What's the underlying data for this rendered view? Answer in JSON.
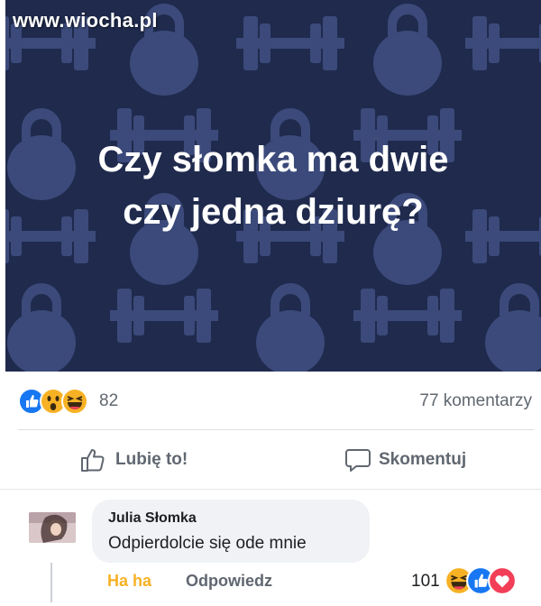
{
  "watermark": "www.wiocha.pl",
  "post": {
    "headline_line1": "Czy słomka ma dwie",
    "headline_line2": "czy jedna dziurę?",
    "image_bg_color": "#1f2a4d",
    "pattern_color": "#3b4a7a"
  },
  "reactions": {
    "icons": [
      "like-icon",
      "wow-icon",
      "haha-icon"
    ],
    "count": "82",
    "comments_count": "77 komentarzy"
  },
  "actions": {
    "like_label": "Lubię to!",
    "comment_label": "Skomentuj"
  },
  "comment": {
    "author": "Julia Słomka",
    "text": "Odpierdolcie się ode mnie",
    "haha_label": "Ha ha",
    "reply_label": "Odpowiedz",
    "reaction_count": "101",
    "reaction_icons": [
      "haha-icon",
      "like-icon",
      "love-icon"
    ]
  },
  "colors": {
    "like_blue": "#1877f2",
    "haha_yellow": "#f7b125",
    "love_red": "#f33e58",
    "text_gray": "#606770"
  }
}
